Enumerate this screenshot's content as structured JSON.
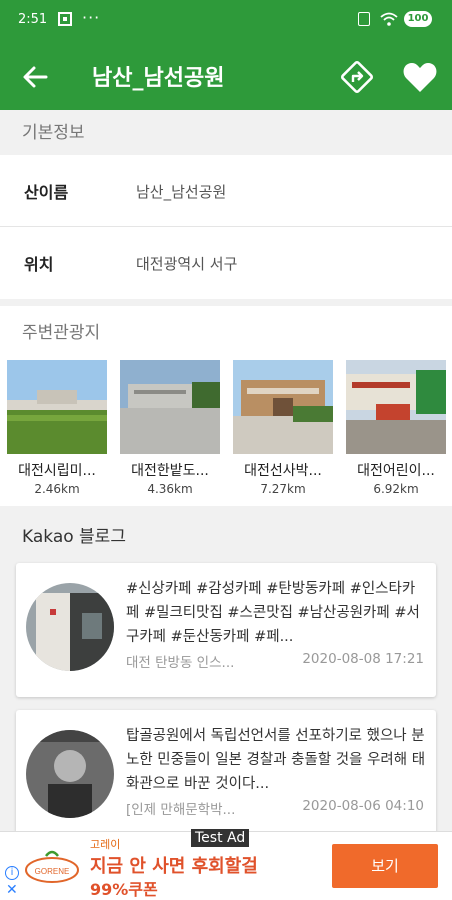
{
  "status_bar": {
    "time": "2:51",
    "more": "···",
    "battery": "100"
  },
  "app_bar": {
    "title": "남산_남선공원"
  },
  "basic_info": {
    "header": "기본정보",
    "rows": [
      {
        "label": "산이름",
        "value": "남산_남선공원"
      },
      {
        "label": "위치",
        "value": "대전광역시 서구"
      }
    ]
  },
  "nearby": {
    "header": "주변관광지",
    "items": [
      {
        "name": "대전시립미...",
        "distance": "2.46km"
      },
      {
        "name": "대전한밭도...",
        "distance": "4.36km"
      },
      {
        "name": "대전선사박...",
        "distance": "7.27km"
      },
      {
        "name": "대전어린이...",
        "distance": "6.92km"
      }
    ]
  },
  "blog": {
    "header": "Kakao 블로그",
    "posts": [
      {
        "text": "#신상카페 #감성카페 #탄방동카페 #인스타카페 #밀크티맛집 #스콘맛집 #남산공원카페 #서구카페 #둔산동카페 #페...",
        "source": "대전 탄방동 인스...",
        "date": "2020-08-08 17:21"
      },
      {
        "text": "탑골공원에서 독립선언서를 선포하기로 했으나 분노한 민중들이 일본 경찰과 충돌할 것을 우려해 태화관으로 바꾼 것이다...",
        "source": "[인제 만해문학박...",
        "date": "2020-08-06 04:10"
      }
    ]
  },
  "ad": {
    "label": "Test Ad",
    "brand": "고레이",
    "logo_text": "GORENE",
    "headline": "지금 안 사면 후회할걸",
    "sub": "99%쿠폰",
    "cta": "보기"
  },
  "colors": {
    "primary": "#2e9a3a",
    "ad_accent": "#f06a2b"
  }
}
